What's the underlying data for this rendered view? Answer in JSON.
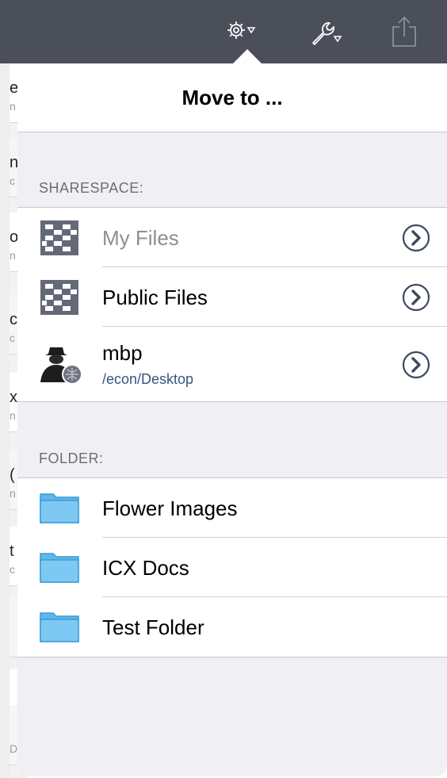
{
  "popover": {
    "title": "Move to ..."
  },
  "sharespace": {
    "label": "SHARESPACE:",
    "items": [
      {
        "label": "My Files",
        "icon": "sharespace-icon",
        "disabled": true
      },
      {
        "label": "Public Files",
        "icon": "sharespace-icon"
      },
      {
        "label": "mbp",
        "sublabel": "/econ/Desktop",
        "icon": "user-computer-icon"
      }
    ]
  },
  "folder": {
    "label": "FOLDER:",
    "items": [
      {
        "label": "Flower Images",
        "icon": "folder-icon"
      },
      {
        "label": "ICX Docs",
        "icon": "folder-icon"
      },
      {
        "label": "Test Folder",
        "icon": "folder-icon"
      }
    ]
  },
  "toolbar": {
    "icons": [
      "gear-icon",
      "wrench-icon",
      "share-icon"
    ],
    "color": "#4a4f59"
  },
  "background_list": {
    "rows": [
      {
        "letter": "e",
        "sub": "n"
      },
      {
        "letter": "n",
        "sub": "c"
      },
      {
        "letter": "o",
        "sub": "n"
      },
      {
        "letter": "c",
        "sub": "c"
      },
      {
        "letter": "x",
        "sub": "n"
      },
      {
        "letter": "(",
        "sub": "n"
      },
      {
        "letter": "t",
        "sub": "c"
      },
      {
        "letter": "",
        "sub": ""
      },
      {
        "letter": "",
        "sub": ""
      },
      {
        "letter": "",
        "sub": "D"
      }
    ]
  },
  "colors": {
    "folder_fill": "#7ec9f3",
    "chevron": "#3d4a60",
    "sublabel": "#36557f"
  }
}
